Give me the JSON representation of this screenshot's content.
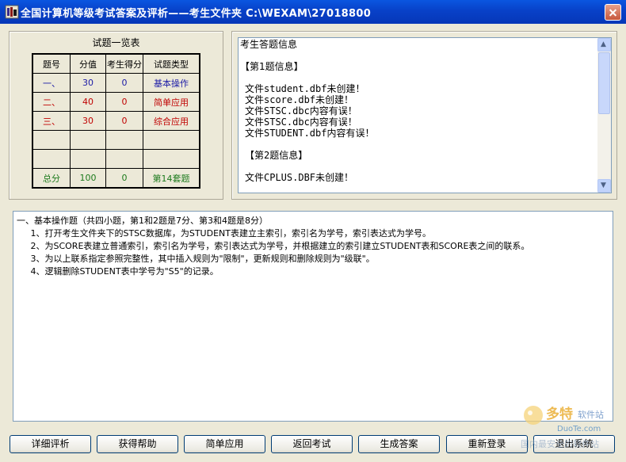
{
  "window": {
    "title": "全国计算机等级考试答案及评析——考生文件夹  C:\\WEXAM\\27018800"
  },
  "summary_table": {
    "caption": "试题一览表",
    "headers": [
      "题号",
      "分值",
      "考生得分",
      "试题类型"
    ],
    "rows": [
      {
        "no": "一、",
        "score": "30",
        "got": "0",
        "type": "基本操作",
        "color": "#1a1aa6"
      },
      {
        "no": "二、",
        "score": "40",
        "got": "0",
        "type": "简单应用",
        "color": "#c00000"
      },
      {
        "no": "三、",
        "score": "30",
        "got": "0",
        "type": "综合应用",
        "color": "#c00000"
      }
    ],
    "total": {
      "label": "总分",
      "score": "100",
      "got": "0",
      "set": "第14套题",
      "color": "#1c7a1c"
    }
  },
  "answer_info": {
    "lines": [
      "考生答题信息",
      "",
      "【第1题信息】",
      "",
      "文件student.dbf未创建！",
      "文件score.dbf未创建！",
      "文件STSC.dbc内容有误！",
      "文件STSC.dbc内容有误！",
      "文件STUDENT.dbf内容有误！",
      "",
      "【第2题信息】",
      "",
      "文件CPLUS.DBF未创建！"
    ]
  },
  "question": {
    "lines": [
      "一、基本操作题（共四小题，第1和2题是7分、第3和4题是8分）",
      "     1、打开考生文件夹下的STSC数据库，为STUDENT表建立主索引，索引名为学号，索引表达式为学号。",
      "     2、为SCORE表建立普通索引，索引名为学号，索引表达式为学号，并根据建立的索引建立STUDENT表和SCORE表之间的联系。",
      "     3、为以上联系指定参照完整性，其中插入规则为\"限制\"，更新规则和删除规则为\"级联\"。",
      "     4、逻辑删除STUDENT表中学号为\"S5\"的记录。"
    ]
  },
  "buttons": {
    "detail": "详细评析",
    "help": "获得帮助",
    "simple": "简单应用",
    "back": "返回考试",
    "generate": "生成答案",
    "relogin": "重新登录",
    "exit": "退出系统"
  },
  "watermark": {
    "brand": "多特",
    "brand_sub": "软件站",
    "url": "DuoTe.com",
    "slogan": "国内最安全的软件站"
  }
}
